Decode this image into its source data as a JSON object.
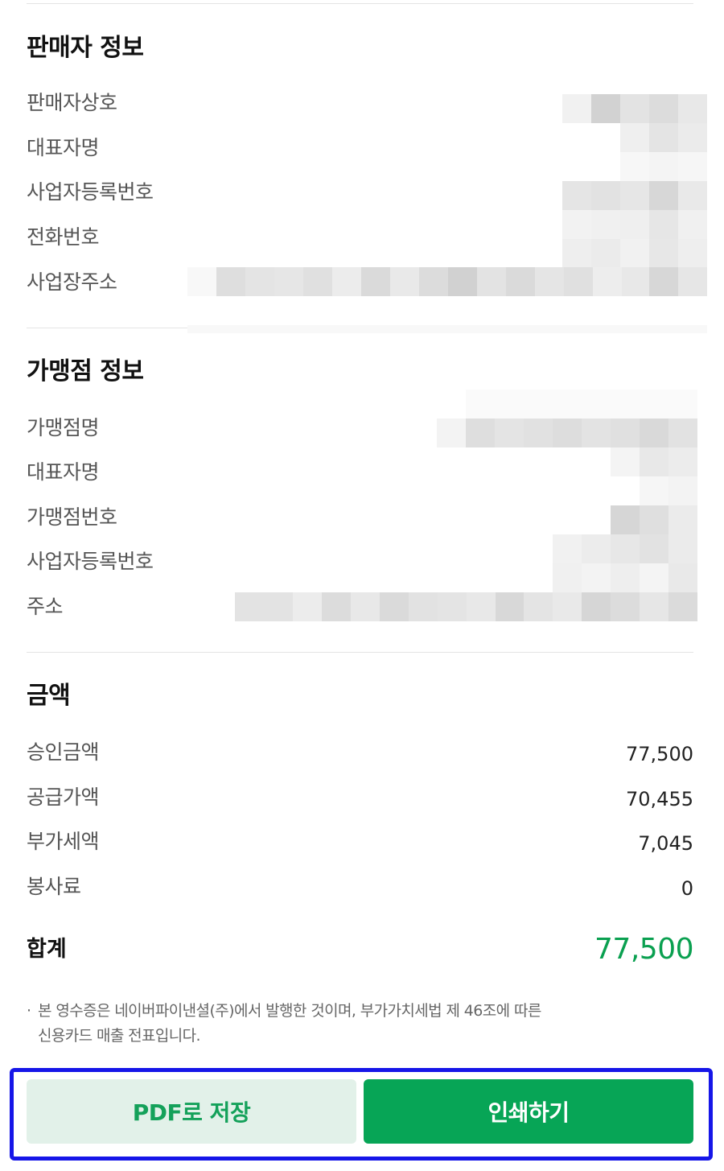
{
  "seller": {
    "title": "판매자 정보",
    "rows": [
      "판매자상호",
      "대표자명",
      "사업자등록번호",
      "전화번호",
      "사업장주소"
    ]
  },
  "merchant": {
    "title": "가맹점 정보",
    "rows": [
      "가맹점명",
      "대표자명",
      "가맹점번호",
      "사업자등록번호",
      "주소"
    ]
  },
  "amount": {
    "title": "금액",
    "rows": [
      {
        "label": "승인금액",
        "value": "77,500"
      },
      {
        "label": "공급가액",
        "value": "70,455"
      },
      {
        "label": "부가세액",
        "value": "7,045"
      },
      {
        "label": "봉사료",
        "value": "0"
      }
    ],
    "total_label": "합계",
    "total_value": "77,500"
  },
  "notice": {
    "bullet": "·",
    "line1": "본 영수증은 네이버파이낸셜(주)에서 발행한 것이며, 부가가치세법 제 46조에 따른",
    "line2": "신용카드 매출 전표입니다."
  },
  "buttons": {
    "pdf_label": "PDF로 저장",
    "print_label": "인쇄하기"
  },
  "colors": {
    "accent_green": "#07a556",
    "total_green": "#0aa050",
    "pdf_bg": "#e2f1e9",
    "highlight_border": "#1616e8"
  }
}
